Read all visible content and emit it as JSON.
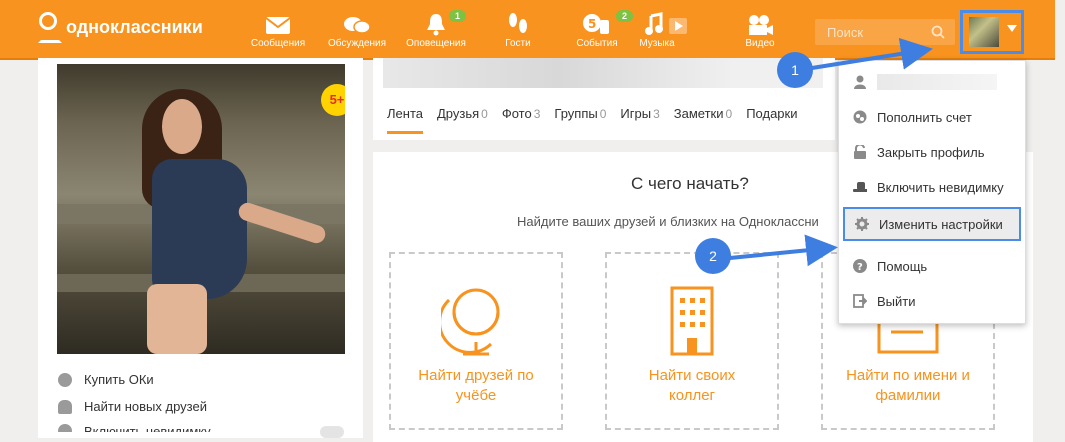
{
  "header": {
    "logo_text": "одноклассники",
    "nav": [
      {
        "label": "Сообщения",
        "icon": "envelope-icon"
      },
      {
        "label": "Обсуждения",
        "icon": "chat-bubbles-icon"
      },
      {
        "label": "Оповещения",
        "icon": "bell-icon",
        "badge": "1"
      },
      {
        "label": "Гости",
        "icon": "footprints-icon"
      },
      {
        "label": "События",
        "icon": "events-icon",
        "badge": "2"
      },
      {
        "label": "Музыка",
        "icon": "music-note-icon"
      },
      {
        "label": "Видео",
        "icon": "video-camera-icon"
      }
    ],
    "search_placeholder": "Поиск",
    "accent": "#f7931e"
  },
  "left": {
    "photo_badge": "5+",
    "menu": [
      "Купить ОКи",
      "Найти новых друзей",
      "Включить невидимку"
    ]
  },
  "profile": {
    "tabs": [
      {
        "label": "Лента",
        "count": ""
      },
      {
        "label": "Друзья",
        "count": "0"
      },
      {
        "label": "Фото",
        "count": "3"
      },
      {
        "label": "Группы",
        "count": "0"
      },
      {
        "label": "Игры",
        "count": "3"
      },
      {
        "label": "Заметки",
        "count": "0"
      },
      {
        "label": "Подарки",
        "count": ""
      }
    ]
  },
  "start": {
    "title": "С чего начать?",
    "subtitle": "Найдите ваших друзей и близких на Одноклассни",
    "cards": [
      {
        "line1": "Найти друзей по",
        "line2": "учёбе"
      },
      {
        "line1": "Найти своих",
        "line2": "коллег"
      },
      {
        "line1": "Найти по имени и",
        "line2": "фамилии"
      }
    ]
  },
  "dropdown": {
    "items": [
      {
        "label": "Пополнить счет",
        "icon": "coins-icon"
      },
      {
        "label": "Закрыть профиль",
        "icon": "unlock-icon"
      },
      {
        "label": "Включить невидимку",
        "icon": "hat-icon"
      },
      {
        "label": "Изменить настройки",
        "icon": "gear-icon"
      },
      {
        "label": "Помощь",
        "icon": "question-icon"
      },
      {
        "label": "Выйти",
        "icon": "exit-icon"
      }
    ]
  },
  "steps": [
    "1",
    "2"
  ]
}
